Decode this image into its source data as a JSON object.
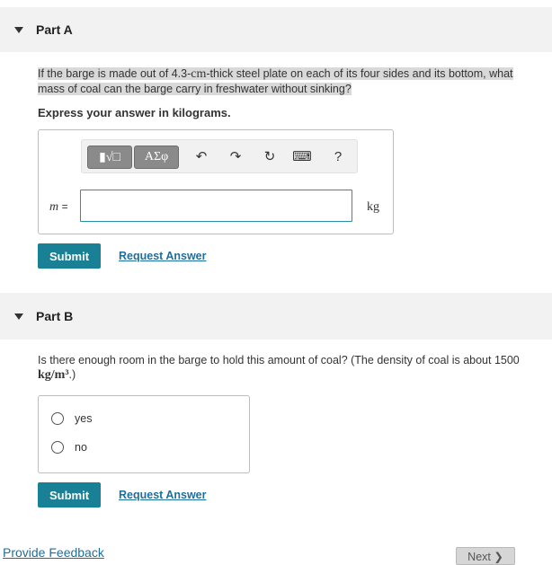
{
  "partA": {
    "title": "Part A",
    "question_pre": "If the barge is made out of 4.3-",
    "question_unit": "cm",
    "question_post": "-thick steel plate on each of its four sides and its bottom, what mass of coal can the barge carry in freshwater without sinking?",
    "instruction": "Express your answer in kilograms.",
    "toolbar": {
      "templates_label": "▮√□",
      "greek_label": "ΑΣφ",
      "undo_icon": "↶",
      "redo_icon": "↷",
      "reset_icon": "↻",
      "keyboard_icon": "⌨",
      "help_label": "?"
    },
    "variable": "m",
    "equals": "=",
    "input_value": "",
    "unit": "kg",
    "submit_label": "Submit",
    "request_label": "Request Answer"
  },
  "partB": {
    "title": "Part B",
    "question_pre": "Is there enough room in the barge to hold this amount of coal? (The density of coal is about 1500 ",
    "question_unit": "kg/m³",
    "question_post": ".)",
    "choices": [
      "yes",
      "no"
    ],
    "submit_label": "Submit",
    "request_label": "Request Answer"
  },
  "footer": {
    "feedback_label": "Provide Feedback",
    "next_label": "Next ❯"
  }
}
